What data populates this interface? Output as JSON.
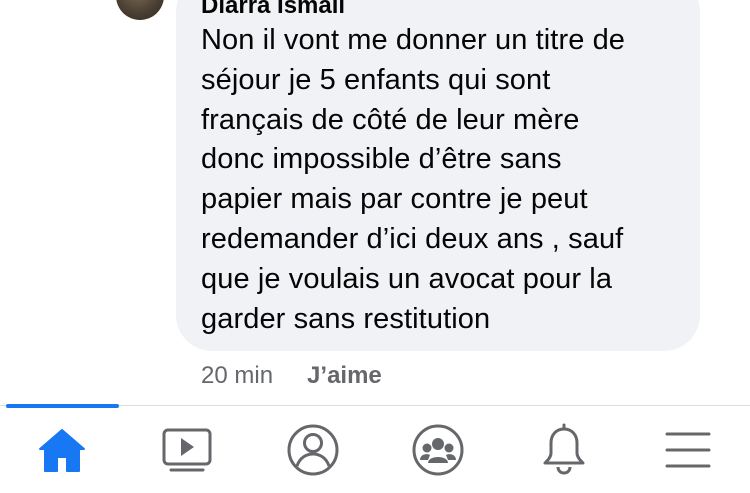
{
  "comment": {
    "author": "Diarra Ismail",
    "text": "Non il vont me donner un titre de\nséjour je 5 enfants qui sont\nfrançais de côté de leur mère\ndonc impossible d’être sans\npapier mais par contre je peut\nredemander d’ici deux ans , sauf\nque je voulais un avocat pour la\ngarder sans restitution",
    "time": "20 min",
    "like_label": "J’aime"
  },
  "nav": {
    "items": [
      {
        "icon": "home-icon",
        "active": true
      },
      {
        "icon": "video-icon",
        "active": false
      },
      {
        "icon": "profile-icon",
        "active": false
      },
      {
        "icon": "groups-icon",
        "active": false
      },
      {
        "icon": "bell-icon",
        "active": false
      },
      {
        "icon": "menu-icon",
        "active": false
      }
    ]
  },
  "colors": {
    "accent": "#1877f2",
    "bubble": "#f0f2f5",
    "secondary_text": "#65676b",
    "icon": "#65676b"
  }
}
